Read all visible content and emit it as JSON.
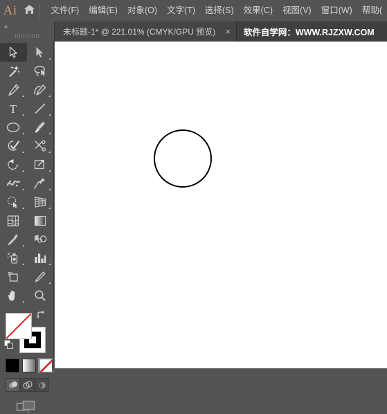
{
  "app": {
    "name": "Ai",
    "logo_color": "#d09a6a"
  },
  "menubar": {
    "home_icon": "home-icon",
    "items": [
      {
        "label": "文件(F)"
      },
      {
        "label": "编辑(E)"
      },
      {
        "label": "对象(O)"
      },
      {
        "label": "文字(T)"
      },
      {
        "label": "选择(S)"
      },
      {
        "label": "效果(C)"
      },
      {
        "label": "视图(V)"
      },
      {
        "label": "窗口(W)"
      },
      {
        "label": "帮助("
      }
    ]
  },
  "tabbar": {
    "collapse_icon": "«",
    "document_tab": {
      "title": "未标题-1* @ 221.01% (CMYK/GPU 预览)",
      "close_label": "×"
    },
    "watermark": "软件自学网：WWW.RJZXW.COM"
  },
  "toolbar": {
    "tools": [
      [
        {
          "name": "selection-tool",
          "icon": "arrow-solid",
          "active": true,
          "corner": false
        },
        {
          "name": "direct-selection-tool",
          "icon": "arrow-filled",
          "active": false,
          "corner": true
        }
      ],
      [
        {
          "name": "magic-wand-tool",
          "icon": "magic-wand",
          "active": false,
          "corner": false
        },
        {
          "name": "lasso-tool",
          "icon": "lasso",
          "active": false,
          "corner": false
        }
      ],
      [
        {
          "name": "pen-tool",
          "icon": "pen",
          "active": false,
          "corner": true
        },
        {
          "name": "curvature-tool",
          "icon": "curvature",
          "active": false,
          "corner": true
        }
      ],
      [
        {
          "name": "type-tool",
          "icon": "type-T",
          "active": false,
          "corner": true
        },
        {
          "name": "line-segment-tool",
          "icon": "line-diagonal",
          "active": false,
          "corner": true
        }
      ],
      [
        {
          "name": "ellipse-tool",
          "icon": "ellipse",
          "active": false,
          "corner": true
        },
        {
          "name": "paintbrush-tool",
          "icon": "paintbrush",
          "active": false,
          "corner": true
        }
      ],
      [
        {
          "name": "shaper-tool",
          "icon": "shaper",
          "active": false,
          "corner": true
        },
        {
          "name": "scissors-tool",
          "icon": "scissors",
          "active": false,
          "corner": true
        }
      ],
      [
        {
          "name": "rotate-tool",
          "icon": "rotate",
          "active": false,
          "corner": true
        },
        {
          "name": "scale-tool",
          "icon": "scale",
          "active": false,
          "corner": true
        }
      ],
      [
        {
          "name": "width-tool",
          "icon": "width-warp",
          "active": false,
          "corner": true
        },
        {
          "name": "free-transform-tool",
          "icon": "pushpin",
          "active": false,
          "corner": true
        }
      ],
      [
        {
          "name": "shape-builder-tool",
          "icon": "shape-builder",
          "active": false,
          "corner": true
        },
        {
          "name": "perspective-grid-tool",
          "icon": "perspective-grid",
          "active": false,
          "corner": true
        }
      ],
      [
        {
          "name": "mesh-tool",
          "icon": "mesh",
          "active": false,
          "corner": false
        },
        {
          "name": "gradient-tool",
          "icon": "gradient",
          "active": false,
          "corner": false
        }
      ],
      [
        {
          "name": "eyedropper-tool",
          "icon": "eyedropper",
          "active": false,
          "corner": true
        },
        {
          "name": "blend-tool",
          "icon": "blend",
          "active": false,
          "corner": false
        }
      ],
      [
        {
          "name": "symbol-sprayer-tool",
          "icon": "symbol-sprayer",
          "active": false,
          "corner": true
        },
        {
          "name": "column-graph-tool",
          "icon": "bar-chart",
          "active": false,
          "corner": true
        }
      ],
      [
        {
          "name": "artboard-tool",
          "icon": "artboard",
          "active": false,
          "corner": false
        },
        {
          "name": "slice-tool",
          "icon": "slice-knife",
          "active": false,
          "corner": true
        }
      ],
      [
        {
          "name": "hand-tool",
          "icon": "hand",
          "active": false,
          "corner": true
        },
        {
          "name": "zoom-tool",
          "icon": "magnifier",
          "active": false,
          "corner": false
        }
      ]
    ],
    "color_controls": {
      "fill": {
        "name": "fill-swatch",
        "value": "none",
        "color": "#ffffff"
      },
      "stroke": {
        "name": "stroke-swatch",
        "value": "black",
        "color": "#000000"
      },
      "swap_icon": "swap-arrow-icon",
      "default_icon": "default-fill-stroke-icon"
    },
    "mode_swatches": [
      {
        "name": "color-mode-swatch",
        "label": "Color",
        "selected": false
      },
      {
        "name": "gradient-mode-swatch",
        "label": "Gradient",
        "selected": false
      },
      {
        "name": "none-mode-swatch",
        "label": "None",
        "selected": true
      }
    ],
    "draw_modes": [
      {
        "name": "draw-normal-mode",
        "label": "Draw Normal",
        "active": true
      },
      {
        "name": "draw-behind-mode",
        "label": "Draw Behind",
        "active": false
      },
      {
        "name": "draw-inside-mode",
        "label": "Draw Inside",
        "active": false
      }
    ],
    "screen_mode": {
      "name": "change-screen-mode",
      "label": "Change Screen Mode"
    }
  },
  "canvas": {
    "background": "#ffffff",
    "artwork": {
      "name": "circle-shape",
      "type": "ellipse",
      "fill": "none",
      "stroke": "#000000",
      "stroke_width": 2
    }
  }
}
